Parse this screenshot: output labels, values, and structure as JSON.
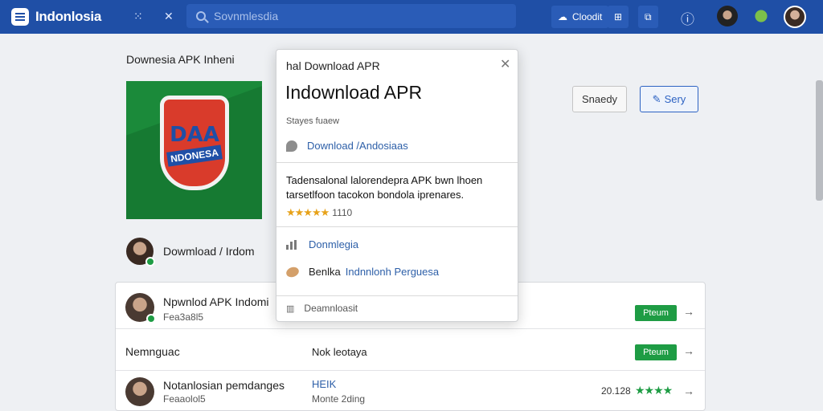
{
  "header": {
    "brand": "Indonlosia",
    "search_placeholder": "Sovnmlesdia",
    "menu_glyph": "⁙",
    "close_glyph": "✕",
    "cloud_btn": "Cloodit",
    "btn2": "⊞",
    "btn3": "⧉",
    "info_glyph": "ⓘ"
  },
  "page": {
    "title": "Downesia APK Inheni",
    "author": "Dowmload / Irdom",
    "buttons": {
      "secondary": "Snaedy",
      "primary": "Sery"
    },
    "shield": {
      "top": "DAA",
      "band": "NDONESA"
    }
  },
  "popup": {
    "header": "hal Download APR",
    "title": "Indownload APR",
    "subtitle": "Stayes fuaew",
    "link": "Download /Andosiaas",
    "description": "Tadensalonal lalorendepra APK bwn lhoen tarsetlfoon tacokon bondola iprenares.",
    "stars": "★★★★★",
    "rating": "1110",
    "item1": "Donmlegia",
    "item2_prefix": "Benlka",
    "item2_link": "Indnnlonh Perguesa",
    "footer": "Deamnloasit"
  },
  "list": {
    "rows": [
      {
        "title": "Npwnlod APK Indomi",
        "sub": "Fea3a8l5",
        "mid": "",
        "mid2": "",
        "action": "Pteum",
        "stars": ""
      },
      {
        "title": "Nemnguac",
        "sub": "",
        "mid": "Nok leotaya",
        "mid2": "",
        "action": "Pteum",
        "stars": ""
      },
      {
        "title": "Notanlosian pemdanges",
        "sub": "Feaaolol5",
        "mid": "HEIK",
        "mid2": "Monte 2ding",
        "action": "",
        "score": "20.128",
        "stars": "★★★★"
      }
    ]
  },
  "colors": {
    "header_bg": "#1f4fa6",
    "accent": "#2d63c3",
    "green": "#1e9c44"
  }
}
